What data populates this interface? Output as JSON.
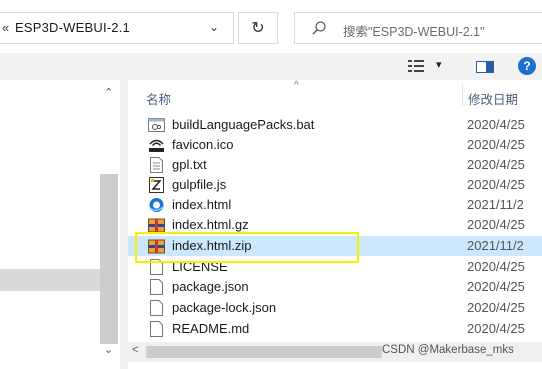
{
  "address_bar": {
    "chevron": "«",
    "path": "ESP3D-WEBUI-2.1",
    "dropdown": "⌄"
  },
  "refresh_glyph": "↻",
  "search": {
    "placeholder": "搜索\"ESP3D-WEBUI-2.1\""
  },
  "toolbar": {
    "view_dropdown": "▾",
    "help": "?"
  },
  "nav_pane": {
    "scroll_up": "⌃",
    "scroll_down": "⌄"
  },
  "file_pane": {
    "sort_indicator": "^",
    "columns": {
      "name": "名称",
      "date": "修改日期"
    },
    "files": [
      {
        "name": "buildLanguagePacks.bat",
        "date": "2020/4/25",
        "icon": "batch-file-icon"
      },
      {
        "name": "favicon.ico",
        "date": "2020/4/25",
        "icon": "esp3d-ico-icon"
      },
      {
        "name": "gpl.txt",
        "date": "2020/4/25",
        "icon": "text-file-icon"
      },
      {
        "name": "gulpfile.js",
        "date": "2020/4/25",
        "icon": "js-file-icon"
      },
      {
        "name": "index.html",
        "date": "2021/11/2",
        "icon": "browser-html-icon"
      },
      {
        "name": "index.html.gz",
        "date": "2020/4/25",
        "icon": "archive-icon"
      },
      {
        "name": "index.html.zip",
        "date": "2021/11/2",
        "icon": "archive-icon",
        "selected": true
      },
      {
        "name": "LICENSE",
        "date": "2020/4/25",
        "icon": "blank-file-icon"
      },
      {
        "name": "package.json",
        "date": "2020/4/25",
        "icon": "blank-file-icon"
      },
      {
        "name": "package-lock.json",
        "date": "2020/4/25",
        "icon": "blank-file-icon"
      },
      {
        "name": "README.md",
        "date": "2020/4/25",
        "icon": "blank-file-icon"
      }
    ],
    "scroll_left": "<"
  },
  "watermark": "CSDN @Makerbase_mks",
  "colors": {
    "selection": "#cce8ff",
    "highlight_box": "#f4f000",
    "help_blue": "#1e6fd2"
  }
}
